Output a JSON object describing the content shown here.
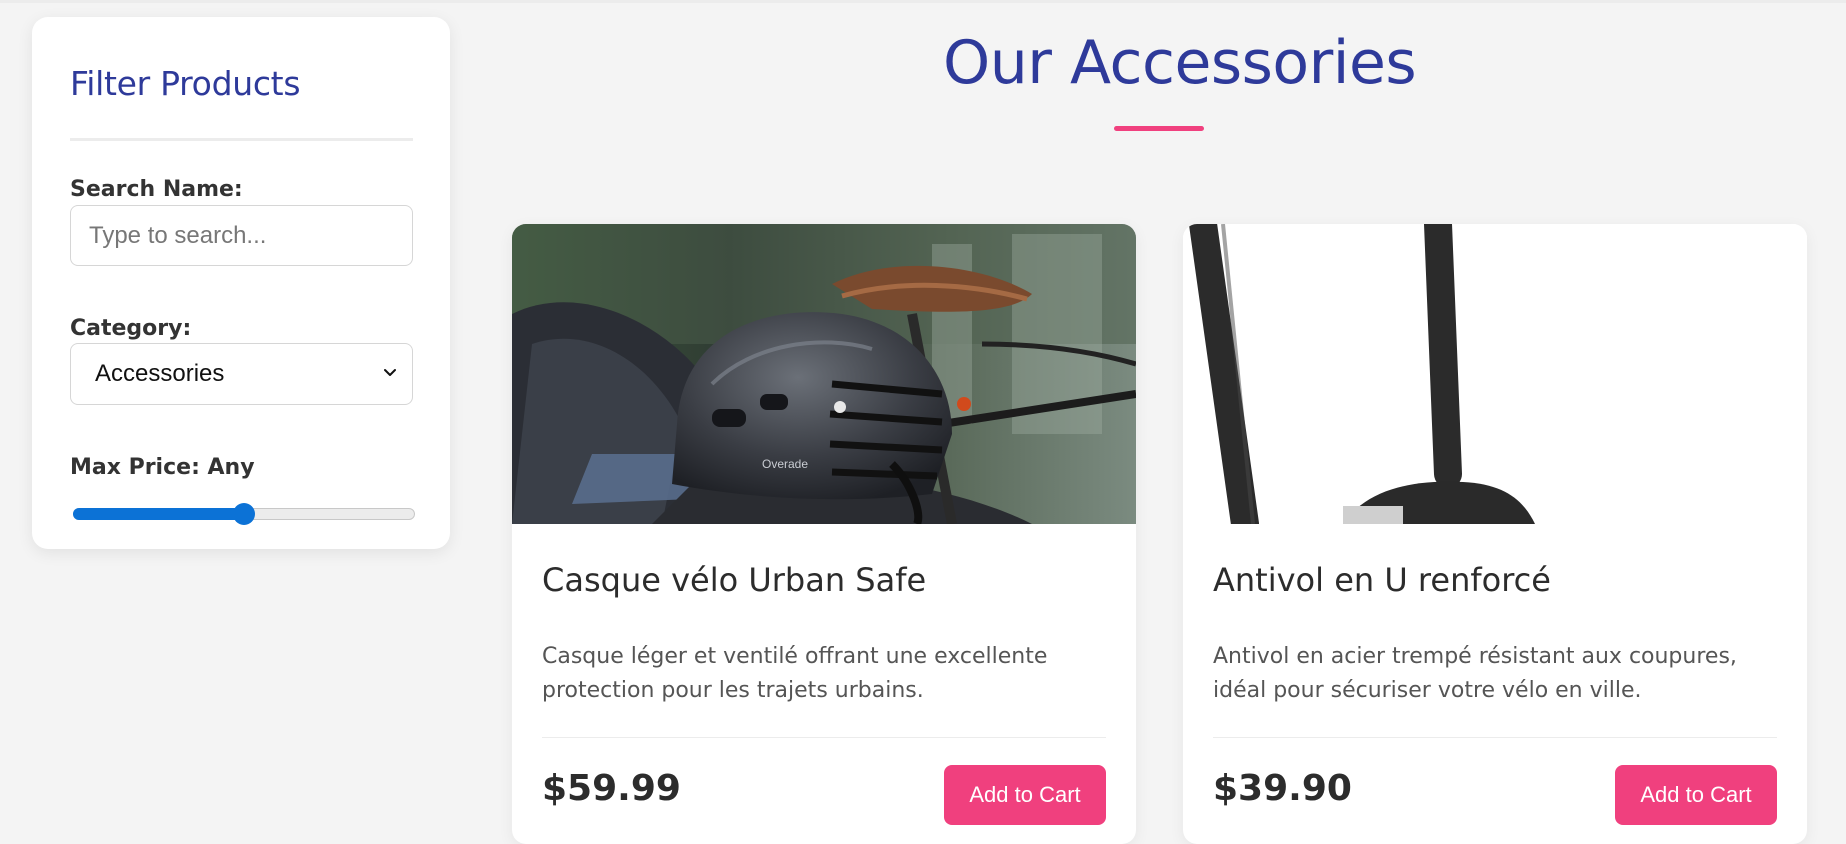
{
  "sidebar": {
    "title": "Filter Products",
    "search_label": "Search Name:",
    "search_placeholder": "Type to search...",
    "search_value": "",
    "category_label": "Category:",
    "category_selected": "Accessories",
    "max_price_label": "Max Price: Any",
    "max_price_slider_fraction": 0.5
  },
  "main": {
    "title": "Our Accessories",
    "products": [
      {
        "name": "Casque vélo Urban Safe",
        "description": "Casque léger et ventilé offrant une excellente protection pour les trajets urbains.",
        "price": "$59.99",
        "button": "Add to Cart",
        "image_icon": "helmet-photo"
      },
      {
        "name": "Antivol en U renforcé",
        "description": "Antivol en acier trempé résistant aux coupures, idéal pour sécuriser votre vélo en ville.",
        "price": "$39.90",
        "button": "Add to Cart",
        "image_icon": "u-lock-photo"
      }
    ]
  },
  "colors": {
    "heading": "#2e3a9a",
    "accent": "#f0407e",
    "slider": "#0c72d6",
    "background": "#f4f4f4"
  }
}
